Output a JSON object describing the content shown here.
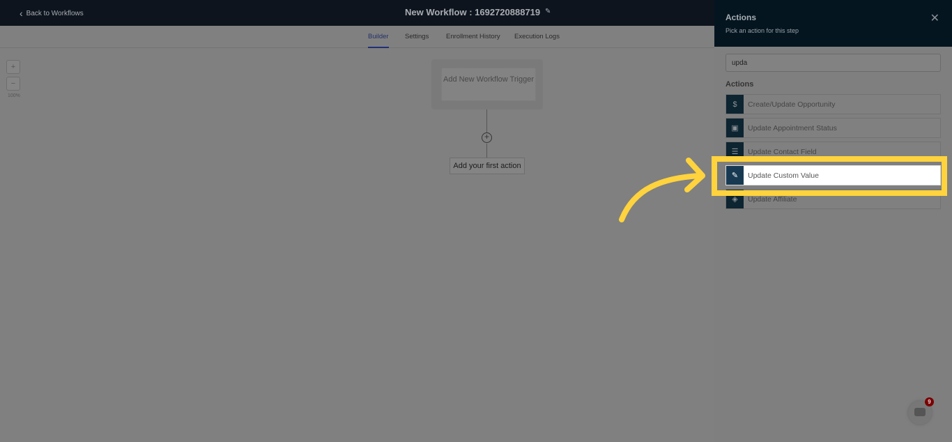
{
  "header": {
    "back_label": "Back to Workflows",
    "title": "New Workflow : 1692720888719"
  },
  "tabs": [
    {
      "label": "Builder",
      "active": true
    },
    {
      "label": "Settings"
    },
    {
      "label": "Enrollment History"
    },
    {
      "label": "Execution Logs"
    }
  ],
  "zoom": {
    "plus": "+",
    "minus": "−",
    "level": "100%"
  },
  "canvas": {
    "trigger": "Add New Workflow Trigger",
    "first_action": "Add your first action"
  },
  "panel": {
    "title": "Actions",
    "subtitle": "Pick an action for this step",
    "search_value": "upda",
    "section": "Actions",
    "items": [
      {
        "label": "Create/Update Opportunity",
        "icon": "dollar-icon"
      },
      {
        "label": "Update Appointment Status",
        "icon": "calendar-check-icon"
      },
      {
        "label": "Update Contact Field",
        "icon": "contact-icon"
      },
      {
        "label": "Update Custom Value",
        "icon": "edit-icon",
        "highlighted": true
      },
      {
        "label": "Update Affiliate",
        "icon": "tag-icon"
      }
    ]
  },
  "chat": {
    "badge": "9"
  },
  "colors": {
    "highlight": "#ffd33d",
    "accent": "#1e2f7a"
  }
}
